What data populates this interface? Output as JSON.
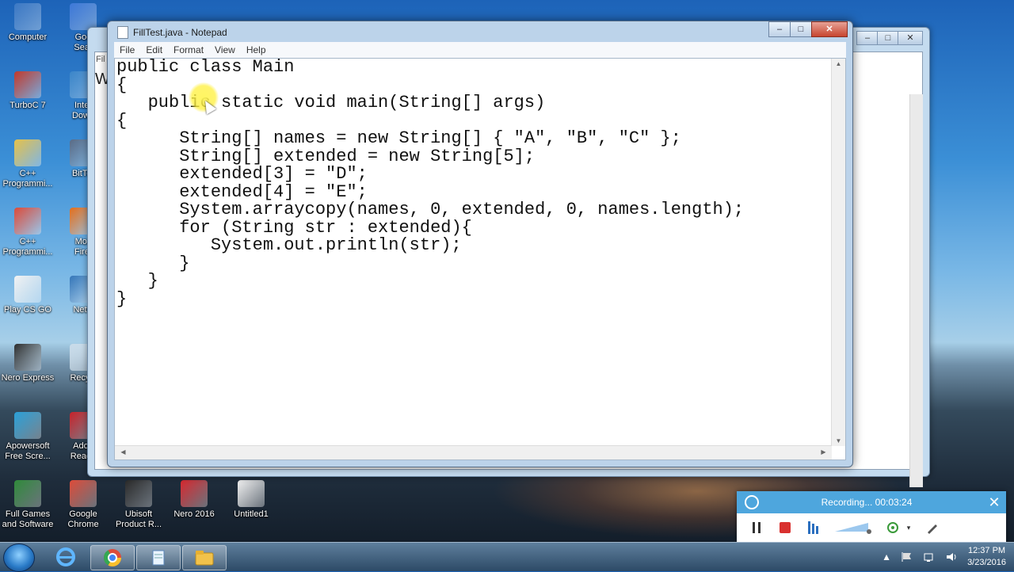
{
  "desktop": {
    "icons": [
      {
        "label": "Computer",
        "color": "#3b78c4"
      },
      {
        "label": "TurboC 7",
        "color": "#c23a2c"
      },
      {
        "label": "C++\nProgrammi...",
        "color": "#e6c24a"
      },
      {
        "label": "C++\nProgrammi...",
        "color": "#dd4b39"
      },
      {
        "label": "Play CS GO",
        "color": "#f2f2f2"
      },
      {
        "label": "Nero Express",
        "color": "#2c2c2c"
      },
      {
        "label": "Apowersoft\nFree Scre...",
        "color": "#2aa0d8"
      },
      {
        "label": "Full Games\nand Software",
        "color": "#2f8a3a"
      },
      {
        "label": "Goo\nSear",
        "color": "#3d78d8"
      },
      {
        "label": "Inter\nDown",
        "color": "#3b86c9"
      },
      {
        "label": "BitTor",
        "color": "#5a6b85"
      },
      {
        "label": "Moz\nFiref",
        "color": "#e56f1b"
      },
      {
        "label": "Netw",
        "color": "#3576b8"
      },
      {
        "label": "Recycl",
        "color": "#c9dbe9"
      },
      {
        "label": "Adob\nReade",
        "color": "#c7222a"
      },
      {
        "label": "Google\nChrome",
        "color": "#dd4b39"
      },
      {
        "label": "Ubisoft\nProduct R...",
        "color": "#2a2a2a"
      },
      {
        "label": "Nero 2016",
        "color": "#d7282f"
      },
      {
        "label": "Untitled1",
        "color": "#f0f0f0"
      }
    ]
  },
  "background_window": {
    "label_partial": "W",
    "tab_partial": "Fil"
  },
  "notepad": {
    "title": "FillTest.java - Notepad",
    "menu": [
      "File",
      "Edit",
      "Format",
      "View",
      "Help"
    ],
    "code": "public class Main\n{\n   public static void main(String[] args)\n{\n      String[] names = new String[] { \"A\", \"B\", \"C\" };\n      String[] extended = new String[5];\n      extended[3] = \"D\";\n      extended[4] = \"E\";\n      System.arraycopy(names, 0, extended, 0, names.length);\n      for (String str : extended){\n         System.out.println(str);\n      }\n   }\n}",
    "controls": {
      "minimize": "–",
      "maximize": "□",
      "close": "✕"
    }
  },
  "recorder": {
    "status": "Recording... 00:03:24",
    "close": "✕"
  },
  "taskbar": {
    "items": [
      "ie-icon",
      "chrome-icon",
      "notepad-icon",
      "explorer-icon"
    ],
    "clock_time": "12:37 PM",
    "clock_date": "3/23/2016"
  }
}
